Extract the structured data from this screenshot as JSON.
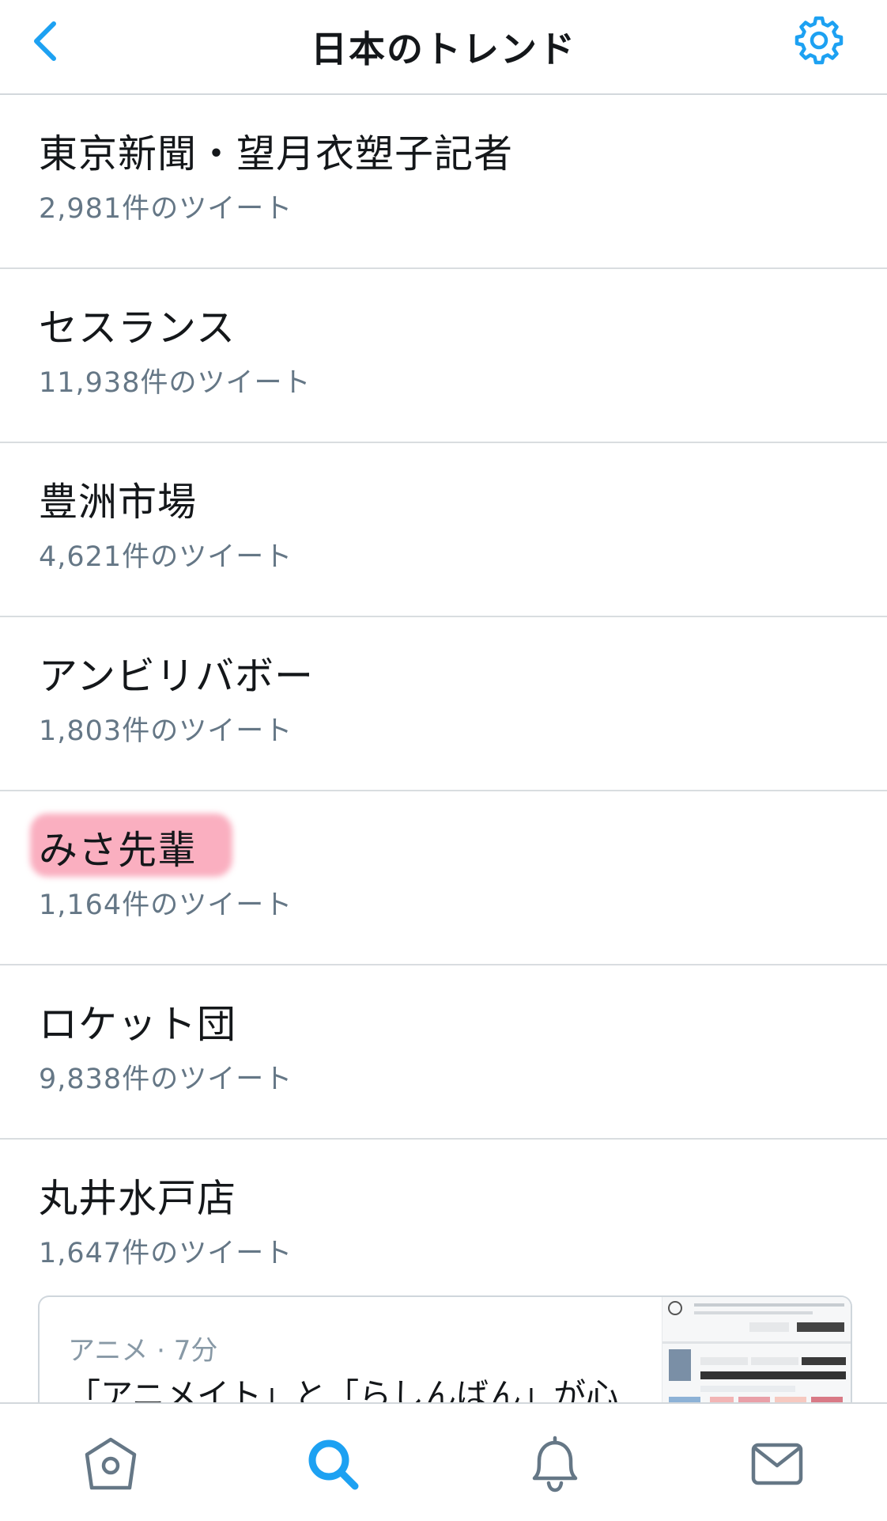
{
  "header": {
    "title": "日本のトレンド",
    "back_icon": "chevron-left-icon",
    "settings_icon": "gear-icon",
    "accent_color": "#1da1f2"
  },
  "trends": [
    {
      "name": "東京新聞・望月衣塑子記者",
      "count": "2,981件のツイート"
    },
    {
      "name": "セスランス",
      "count": "11,938件のツイート"
    },
    {
      "name": "豊洲市場",
      "count": "4,621件のツイート"
    },
    {
      "name": "アンビリバボー",
      "count": "1,803件のツイート"
    },
    {
      "name": "みさ先輩",
      "count": "1,164件のツイート",
      "highlighted": true
    },
    {
      "name": "ロケット団",
      "count": "9,838件のツイート"
    },
    {
      "name": "丸井水戸店",
      "count": "1,647件のツイート"
    }
  ],
  "news_card": {
    "meta": "アニメ · 7分",
    "headline": "「アニメイト」と「らしんばん」が心"
  },
  "tabbar": {
    "items": [
      "home-icon",
      "search-icon",
      "notifications-icon",
      "messages-icon"
    ],
    "active": "search-icon"
  }
}
